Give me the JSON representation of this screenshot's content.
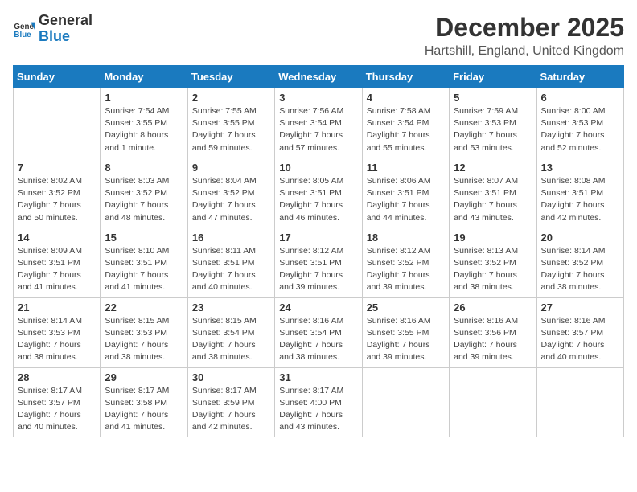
{
  "logo": {
    "text_general": "General",
    "text_blue": "Blue"
  },
  "title": "December 2025",
  "subtitle": "Hartshill, England, United Kingdom",
  "days_of_week": [
    "Sunday",
    "Monday",
    "Tuesday",
    "Wednesday",
    "Thursday",
    "Friday",
    "Saturday"
  ],
  "weeks": [
    [
      {
        "day": "",
        "info": ""
      },
      {
        "day": "1",
        "info": "Sunrise: 7:54 AM\nSunset: 3:55 PM\nDaylight: 8 hours\nand 1 minute."
      },
      {
        "day": "2",
        "info": "Sunrise: 7:55 AM\nSunset: 3:55 PM\nDaylight: 7 hours\nand 59 minutes."
      },
      {
        "day": "3",
        "info": "Sunrise: 7:56 AM\nSunset: 3:54 PM\nDaylight: 7 hours\nand 57 minutes."
      },
      {
        "day": "4",
        "info": "Sunrise: 7:58 AM\nSunset: 3:54 PM\nDaylight: 7 hours\nand 55 minutes."
      },
      {
        "day": "5",
        "info": "Sunrise: 7:59 AM\nSunset: 3:53 PM\nDaylight: 7 hours\nand 53 minutes."
      },
      {
        "day": "6",
        "info": "Sunrise: 8:00 AM\nSunset: 3:53 PM\nDaylight: 7 hours\nand 52 minutes."
      }
    ],
    [
      {
        "day": "7",
        "info": "Sunrise: 8:02 AM\nSunset: 3:52 PM\nDaylight: 7 hours\nand 50 minutes."
      },
      {
        "day": "8",
        "info": "Sunrise: 8:03 AM\nSunset: 3:52 PM\nDaylight: 7 hours\nand 48 minutes."
      },
      {
        "day": "9",
        "info": "Sunrise: 8:04 AM\nSunset: 3:52 PM\nDaylight: 7 hours\nand 47 minutes."
      },
      {
        "day": "10",
        "info": "Sunrise: 8:05 AM\nSunset: 3:51 PM\nDaylight: 7 hours\nand 46 minutes."
      },
      {
        "day": "11",
        "info": "Sunrise: 8:06 AM\nSunset: 3:51 PM\nDaylight: 7 hours\nand 44 minutes."
      },
      {
        "day": "12",
        "info": "Sunrise: 8:07 AM\nSunset: 3:51 PM\nDaylight: 7 hours\nand 43 minutes."
      },
      {
        "day": "13",
        "info": "Sunrise: 8:08 AM\nSunset: 3:51 PM\nDaylight: 7 hours\nand 42 minutes."
      }
    ],
    [
      {
        "day": "14",
        "info": "Sunrise: 8:09 AM\nSunset: 3:51 PM\nDaylight: 7 hours\nand 41 minutes."
      },
      {
        "day": "15",
        "info": "Sunrise: 8:10 AM\nSunset: 3:51 PM\nDaylight: 7 hours\nand 41 minutes."
      },
      {
        "day": "16",
        "info": "Sunrise: 8:11 AM\nSunset: 3:51 PM\nDaylight: 7 hours\nand 40 minutes."
      },
      {
        "day": "17",
        "info": "Sunrise: 8:12 AM\nSunset: 3:51 PM\nDaylight: 7 hours\nand 39 minutes."
      },
      {
        "day": "18",
        "info": "Sunrise: 8:12 AM\nSunset: 3:52 PM\nDaylight: 7 hours\nand 39 minutes."
      },
      {
        "day": "19",
        "info": "Sunrise: 8:13 AM\nSunset: 3:52 PM\nDaylight: 7 hours\nand 38 minutes."
      },
      {
        "day": "20",
        "info": "Sunrise: 8:14 AM\nSunset: 3:52 PM\nDaylight: 7 hours\nand 38 minutes."
      }
    ],
    [
      {
        "day": "21",
        "info": "Sunrise: 8:14 AM\nSunset: 3:53 PM\nDaylight: 7 hours\nand 38 minutes."
      },
      {
        "day": "22",
        "info": "Sunrise: 8:15 AM\nSunset: 3:53 PM\nDaylight: 7 hours\nand 38 minutes."
      },
      {
        "day": "23",
        "info": "Sunrise: 8:15 AM\nSunset: 3:54 PM\nDaylight: 7 hours\nand 38 minutes."
      },
      {
        "day": "24",
        "info": "Sunrise: 8:16 AM\nSunset: 3:54 PM\nDaylight: 7 hours\nand 38 minutes."
      },
      {
        "day": "25",
        "info": "Sunrise: 8:16 AM\nSunset: 3:55 PM\nDaylight: 7 hours\nand 39 minutes."
      },
      {
        "day": "26",
        "info": "Sunrise: 8:16 AM\nSunset: 3:56 PM\nDaylight: 7 hours\nand 39 minutes."
      },
      {
        "day": "27",
        "info": "Sunrise: 8:16 AM\nSunset: 3:57 PM\nDaylight: 7 hours\nand 40 minutes."
      }
    ],
    [
      {
        "day": "28",
        "info": "Sunrise: 8:17 AM\nSunset: 3:57 PM\nDaylight: 7 hours\nand 40 minutes."
      },
      {
        "day": "29",
        "info": "Sunrise: 8:17 AM\nSunset: 3:58 PM\nDaylight: 7 hours\nand 41 minutes."
      },
      {
        "day": "30",
        "info": "Sunrise: 8:17 AM\nSunset: 3:59 PM\nDaylight: 7 hours\nand 42 minutes."
      },
      {
        "day": "31",
        "info": "Sunrise: 8:17 AM\nSunset: 4:00 PM\nDaylight: 7 hours\nand 43 minutes."
      },
      {
        "day": "",
        "info": ""
      },
      {
        "day": "",
        "info": ""
      },
      {
        "day": "",
        "info": ""
      }
    ]
  ]
}
